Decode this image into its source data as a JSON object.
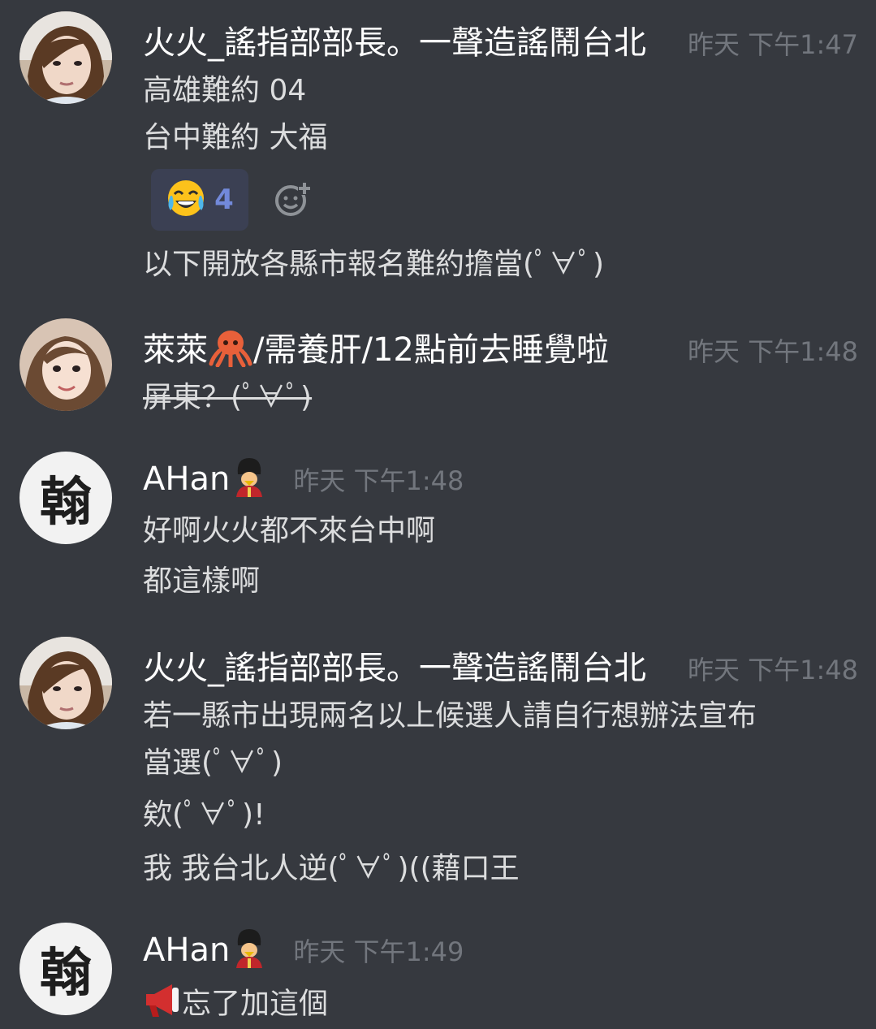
{
  "messages": [
    {
      "username": "火火_謠指部部長。一聲造謠鬧台北",
      "timestamp": "昨天 下午1:47",
      "lines": [
        "高雄難約 04",
        "台中難約 大福"
      ],
      "reaction": {
        "emoji": "face-with-tears-of-joy",
        "count": "4"
      },
      "after_reaction_line": "以下開放各縣市報名難約擔當(ﾟ∀ﾟ)"
    },
    {
      "username_prefix": "萊萊",
      "username_suffix": "/需養肝/12點前去睡覺啦",
      "username_emoji": "octopus",
      "timestamp": "昨天 下午1:48",
      "lines": [
        "屏東？(ﾟ∀ﾟ)"
      ]
    },
    {
      "username": "AHan",
      "username_emoji": "guardsman",
      "avatar_char": "翰",
      "timestamp": "昨天 下午1:48",
      "lines": [
        "好啊火火都不來台中啊",
        "都這樣啊"
      ]
    },
    {
      "username": "火火_謠指部部長。一聲造謠鬧台北",
      "timestamp": "昨天 下午1:48",
      "lines": [
        "若一縣市出現兩名以上候選人請自行想辦法宣布",
        "當選(ﾟ∀ﾟ)",
        "欸(ﾟ∀ﾟ)!",
        "我 我台北人逆(ﾟ∀ﾟ)((藉口王"
      ]
    },
    {
      "username": "AHan",
      "username_emoji": "guardsman",
      "avatar_char": "翰",
      "timestamp": "昨天 下午1:49",
      "lines": [
        "忘了加這個"
      ],
      "line_emoji": "megaphone"
    }
  ],
  "colors": {
    "background": "#36393f",
    "username": "#ffffff",
    "text": "#dcddde",
    "timestamp": "#72767d",
    "reaction_bg": "#3b4053",
    "reaction_count": "#7289da"
  }
}
